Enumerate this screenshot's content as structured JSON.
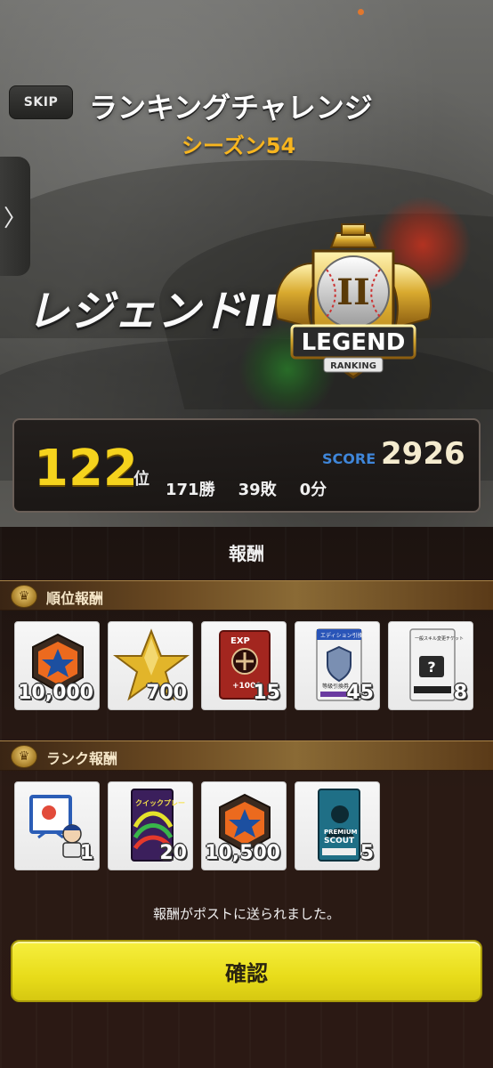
{
  "header": {
    "skip_label": "SKIP",
    "title": "ランキングチャレンジ",
    "season": "シーズン54",
    "side_tab_glyph": "〉"
  },
  "rank": {
    "name": "レジェンドII",
    "badge_text": "LEGEND",
    "badge_subtext": "RANKING",
    "badge_tier": "II"
  },
  "stats": {
    "position": "122",
    "position_unit": "位",
    "wins": "171勝",
    "losses": "39敗",
    "draws": "0分",
    "score_label": "SCORE",
    "score_value": "2926"
  },
  "rewards": {
    "title": "報酬",
    "placement_section_label": "順位報酬",
    "placement_items": [
      {
        "icon": "orange-star-medal-icon",
        "qty": "10,000"
      },
      {
        "icon": "gold-star-icon",
        "qty": "700"
      },
      {
        "icon": "exp-card-icon",
        "qty": "15",
        "card_label": "EXP",
        "card_sub": "+1000"
      },
      {
        "icon": "exchange-ticket-icon",
        "qty": "45",
        "card_label": "エディション引換",
        "card_sub": "等級引換券"
      },
      {
        "icon": "skill-change-ticket-icon",
        "qty": "8",
        "card_label": "一般スキル変更チケット"
      }
    ],
    "rank_section_label": "ランク報酬",
    "rank_items": [
      {
        "icon": "player-board-icon",
        "qty": "1"
      },
      {
        "icon": "quick-play-card-icon",
        "qty": "20",
        "card_label": "クイックプレー"
      },
      {
        "icon": "orange-star-medal-icon",
        "qty": "10,500"
      },
      {
        "icon": "premium-scout-icon",
        "qty": "5",
        "card_label": "PREMIUM",
        "card_sub": "SCOUT"
      }
    ],
    "notice": "報酬がポストに送られました。",
    "confirm_label": "確認"
  },
  "colors": {
    "accent_yellow": "#f5d31d",
    "season_orange": "#f7b51f",
    "score_blue": "#3f86d9",
    "confirm_yellow": "#ece21f"
  }
}
